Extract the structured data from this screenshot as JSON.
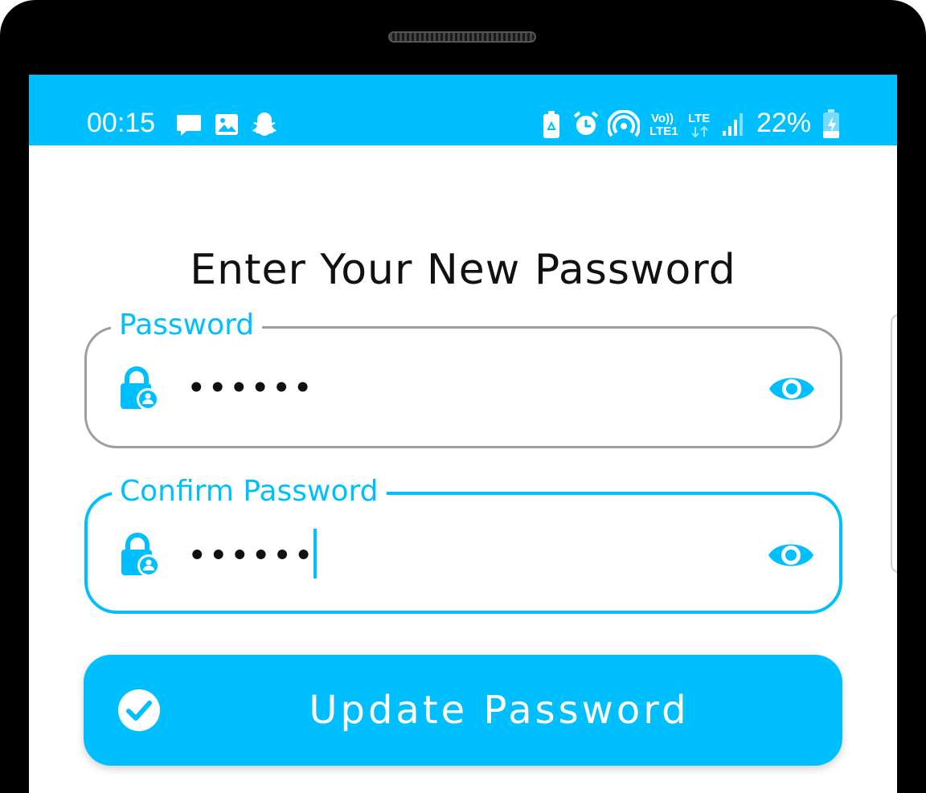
{
  "status_bar": {
    "time": "00:15",
    "network_label_top": "Vo))",
    "network_label_bottom": "LTE1",
    "lte_label": "LTE",
    "battery_percent": "22%",
    "icons": [
      "message-icon",
      "image-icon",
      "snapchat-icon",
      "battery-saver-icon",
      "alarm-icon",
      "hotspot-icon",
      "volte-icon",
      "lte-arrows-icon",
      "signal-icon",
      "battery-charging-icon"
    ]
  },
  "page": {
    "title": "Enter Your New Password"
  },
  "password_field": {
    "label": "Password",
    "value": "••••••",
    "icon": "lock-user-icon",
    "toggle_icon": "eye-icon"
  },
  "confirm_field": {
    "label": "Confirm Password",
    "value": "••••••",
    "icon": "lock-user-icon",
    "toggle_icon": "eye-icon",
    "focused": true
  },
  "update_button": {
    "label": "Update Password",
    "icon": "check-circle-icon"
  },
  "colors": {
    "accent": "#00bfff",
    "idle_border": "#9e9e9e",
    "text": "#111111"
  }
}
